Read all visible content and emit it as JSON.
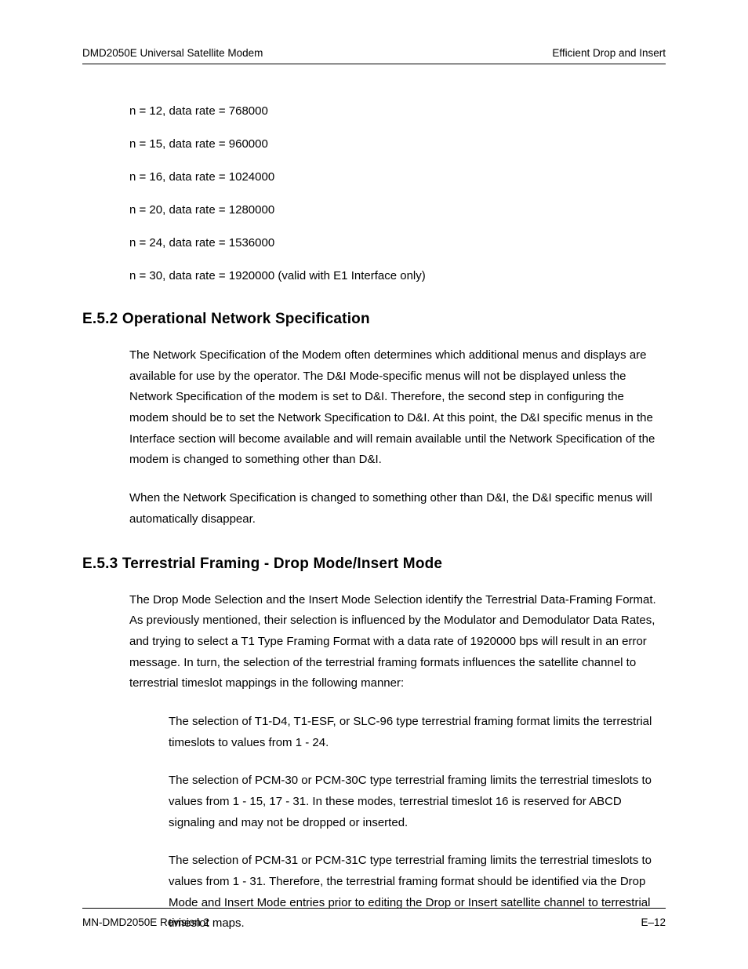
{
  "header": {
    "left": "DMD2050E Universal Satellite Modem",
    "right": "Efficient Drop and Insert"
  },
  "rates": {
    "r1": "n = 12, data rate = 768000",
    "r2": "n = 15, data rate = 960000",
    "r3": "n = 16, data rate = 1024000",
    "r4": "n = 20, data rate = 1280000",
    "r5": "n = 24, data rate = 1536000",
    "r6": "n = 30, data rate = 1920000 (valid with E1 Interface only)"
  },
  "section_e52": {
    "heading": "E.5.2  Operational Network Specification",
    "p1": "The Network Specification of the Modem often determines which additional menus and displays are available for use by the operator.  The D&I Mode-specific menus will not be displayed unless the Network Specification of the modem is set to D&I.  Therefore, the second step in configuring the modem should be to set the Network Specification to D&I.  At this point, the D&I specific menus in the Interface section will become available and will remain available until the Network Specification of the modem is changed to something other than D&I.",
    "p2": "When the Network Specification is changed to something other than D&I, the D&I specific menus will automatically disappear."
  },
  "section_e53": {
    "heading": "E.5.3  Terrestrial Framing - Drop Mode/Insert Mode",
    "p1": "The Drop Mode Selection and the Insert Mode Selection identify the Terrestrial Data-Framing Format.  As previously mentioned, their selection is influenced by the Modulator and Demodulator Data Rates, and trying to select a T1 Type Framing Format with a data rate of 1920000 bps will result in an error message.  In turn, the selection of the terrestrial framing formats influences the satellite channel to terrestrial timeslot mappings in the following manner:",
    "sub1": "The selection of T1-D4, T1-ESF, or SLC-96 type terrestrial framing format limits the terrestrial timeslots to values from 1 - 24.",
    "sub2": "The selection of PCM-30 or PCM-30C type terrestrial framing limits the terrestrial timeslots to values from 1 - 15, 17 - 31.  In these modes, terrestrial timeslot 16 is reserved for ABCD signaling and may not be dropped or inserted.",
    "sub3": "The selection of PCM-31 or PCM-31C type terrestrial framing limits the terrestrial timeslots to values from 1 - 31.  Therefore, the terrestrial framing format should be identified via the Drop Mode and Insert Mode entries prior to editing the Drop or Insert satellite channel to terrestrial timeslot maps."
  },
  "footer": {
    "left": "MN-DMD2050E   Revision 2",
    "right": "E–12"
  }
}
